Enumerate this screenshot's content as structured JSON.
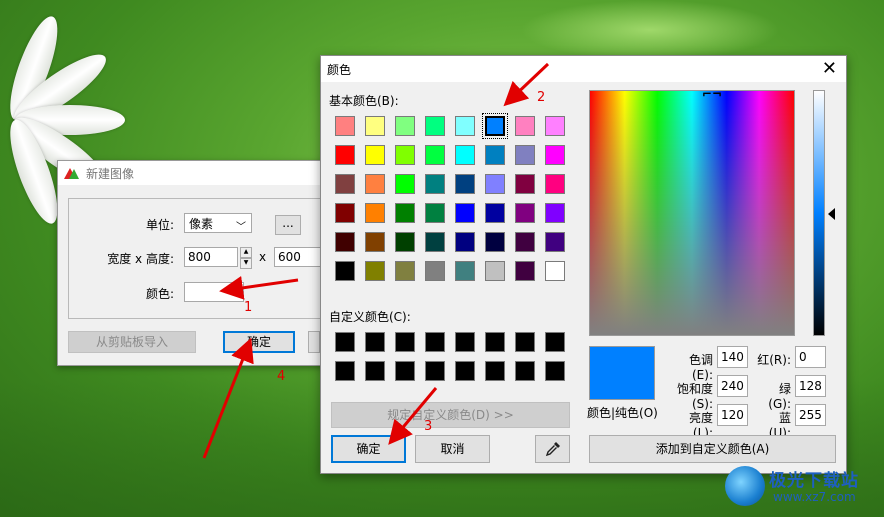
{
  "new_image_dialog": {
    "title": "新建图像",
    "unit_label": "单位:",
    "unit_value": "像素",
    "more_button": "...",
    "size_label": "宽度 x 高度:",
    "width_value": "800",
    "times": "x",
    "height_value": "600",
    "color_label": "颜色:",
    "import_button": "从剪贴板导入",
    "ok_button": "确定"
  },
  "color_dialog": {
    "title": "颜色",
    "close_glyph": "✕",
    "basic_colors_label": "基本颜色(B):",
    "basic_colors": [
      "#ff8080",
      "#ffff80",
      "#80ff80",
      "#00ff80",
      "#80ffff",
      "#0080ff",
      "#ff80c0",
      "#ff80ff",
      "#ff0000",
      "#ffff00",
      "#80ff00",
      "#00ff40",
      "#00ffff",
      "#0080c0",
      "#8080c0",
      "#ff00ff",
      "#804040",
      "#ff8040",
      "#00ff00",
      "#008080",
      "#004080",
      "#8080ff",
      "#800040",
      "#ff0080",
      "#800000",
      "#ff8000",
      "#008000",
      "#008040",
      "#0000ff",
      "#0000a0",
      "#800080",
      "#8000ff",
      "#400000",
      "#804000",
      "#004000",
      "#004040",
      "#000080",
      "#000040",
      "#400040",
      "#400080",
      "#000000",
      "#808000",
      "#808040",
      "#808080",
      "#408080",
      "#c0c0c0",
      "#400040",
      "#ffffff"
    ],
    "selected_index": 5,
    "custom_colors_label": "自定义颜色(C):",
    "custom_colors": [
      "#000000",
      "#000000",
      "#000000",
      "#000000",
      "#000000",
      "#000000",
      "#000000",
      "#000000",
      "#000000",
      "#000000",
      "#000000",
      "#000000",
      "#000000",
      "#000000",
      "#000000",
      "#000000"
    ],
    "define_custom_button": "规定自定义颜色(D) >>",
    "ok_button": "确定",
    "cancel_button": "取消",
    "preview_color": "#0080ff",
    "preview_label": "颜色|纯色(O)",
    "hue_label": "色调(E):",
    "hue_value": "140",
    "sat_label": "饱和度(S):",
    "sat_value": "240",
    "lum_label": "亮度(L):",
    "lum_value": "120",
    "red_label": "红(R):",
    "red_value": "0",
    "green_label": "绿(G):",
    "green_value": "128",
    "blue_label": "蓝(U):",
    "blue_value": "255",
    "add_custom_button": "添加到自定义颜色(A)"
  },
  "annotations": {
    "marker_1": "1",
    "marker_2": "2",
    "marker_3": "3",
    "marker_4": "4",
    "arrow_color": "#e10000"
  },
  "watermark": {
    "title": "极光下载站",
    "url": "www.xz7.com"
  }
}
